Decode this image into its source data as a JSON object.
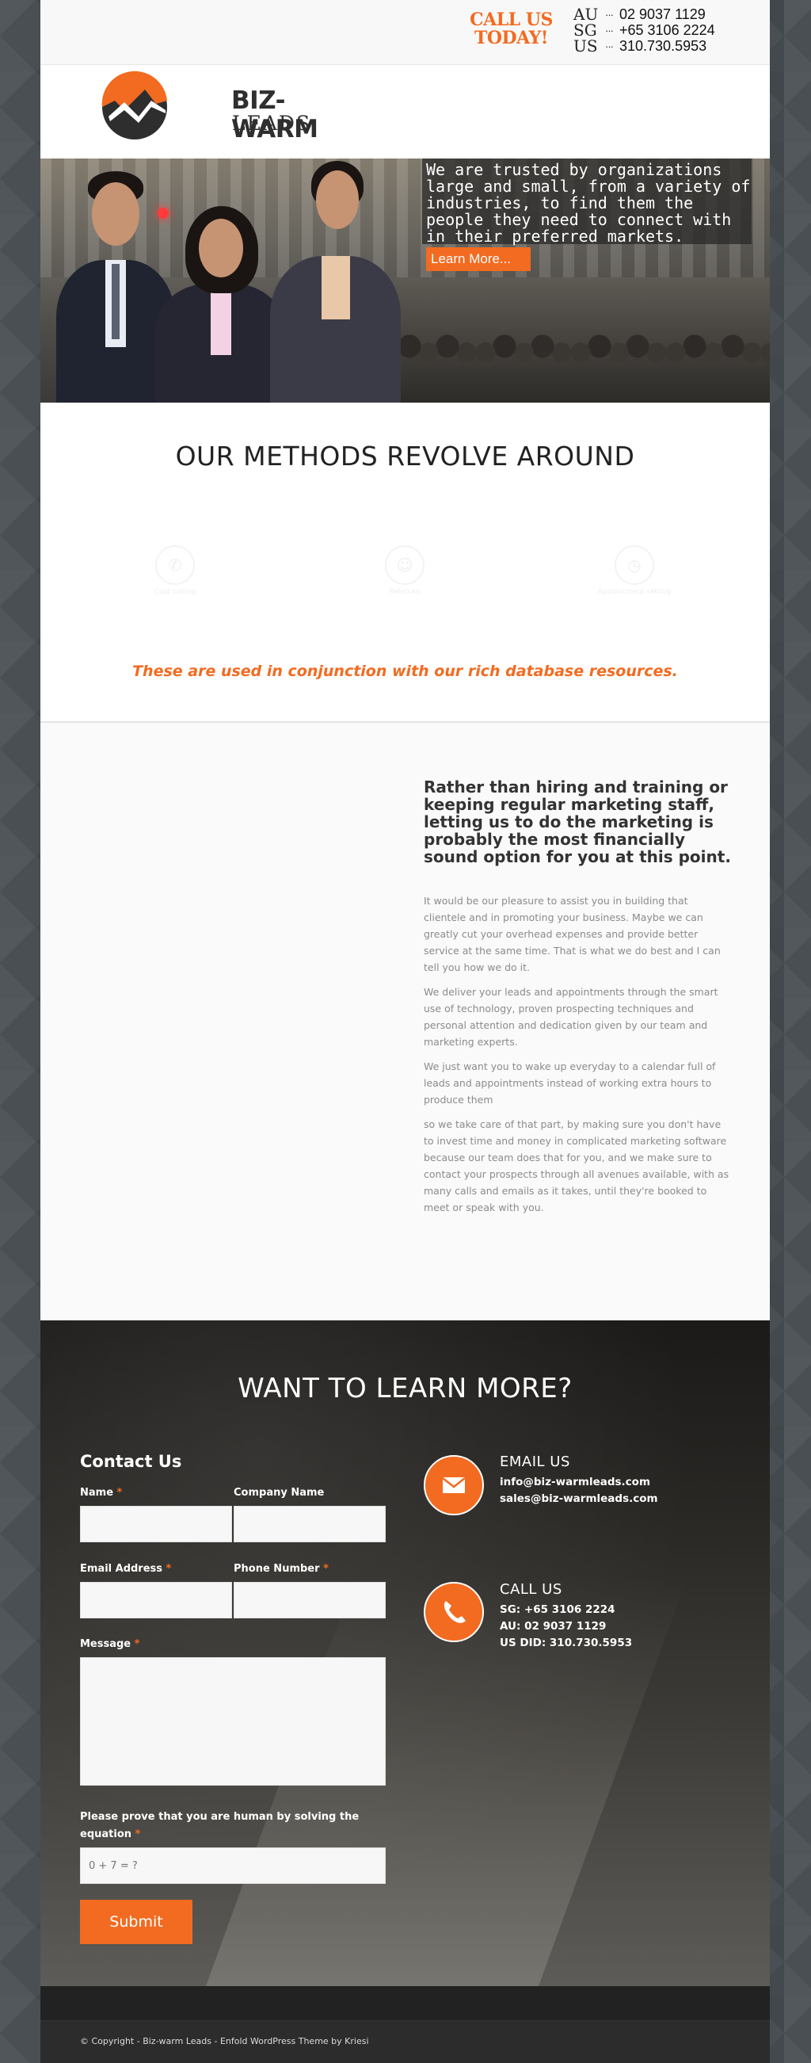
{
  "topbar": {
    "call_us": "CALL US",
    "today": "TODAY!",
    "phones": [
      {
        "country": "AU",
        "number": "02 9037 1129"
      },
      {
        "country": "SG",
        "number": "+65 3106 2224"
      },
      {
        "country": "US",
        "number": "310.730.5953"
      }
    ]
  },
  "logo": {
    "name": "BIZ-WARM",
    "sub": "LEADS"
  },
  "hero": {
    "text": "We are trusted by organizations large and small, from a variety of industries, to find them the people they need to connect with in their preferred markets.",
    "button": "Learn More..."
  },
  "methods": {
    "title": "OUR METHODS REVOLVE AROUND",
    "items": [
      {
        "icon": "phone-icon",
        "label": "Cold calling"
      },
      {
        "icon": "people-icon",
        "label": "Referrals"
      },
      {
        "icon": "clock-icon",
        "label": "Appointment setting"
      }
    ],
    "note": "These are used in conjunction with our rich database resources."
  },
  "content": {
    "heading": "Rather than hiring and training or keeping regular marketing staff, letting us to do the marketing is probably the most financially sound option for you at this point.",
    "paragraphs": [
      "It would be our pleasure to assist you in building that clientele and in promoting your business. Maybe we can greatly cut your overhead expenses and provide better service at the same time. That is what we do best and I can tell you how we do it.",
      "We deliver your leads and appointments through the smart use of technology, proven prospecting techniques and personal attention and dedication given by our team and marketing experts.",
      "We just want you to wake up everyday to a calendar full of leads and appointments instead of working extra hours to produce them",
      "so we take care of that part, by making sure you don't have to invest time and money in complicated marketing software because our team does that for you, and we make sure to contact your prospects through all avenues available, with as many calls and emails as it takes, until they're booked to meet or speak with you."
    ]
  },
  "learn": {
    "title": "WANT TO LEARN MORE?",
    "form": {
      "title": "Contact Us",
      "name_label": "Name",
      "company_label": "Company Name",
      "email_label": "Email Address",
      "phone_label": "Phone Number",
      "message_label": "Message",
      "captcha_label": "Please prove that you are human by solving the equation",
      "captcha_placeholder": "0 + 7 = ?",
      "required_mark": "*",
      "submit": "Submit"
    },
    "email": {
      "title": "EMAIL US",
      "lines": [
        "info@biz-warmleads.com",
        "sales@biz-warmleads.com"
      ]
    },
    "call": {
      "title": "CALL US",
      "lines": [
        "SG: +65 3106 2224",
        "AU: 02 9037 1129",
        "US DID: 310.730.5953"
      ]
    }
  },
  "footer": {
    "copyright": "© Copyright - Biz-warm Leads - Enfold WordPress Theme by Kriesi"
  },
  "colors": {
    "accent": "#f26b21",
    "dark": "#2c2c2c"
  }
}
